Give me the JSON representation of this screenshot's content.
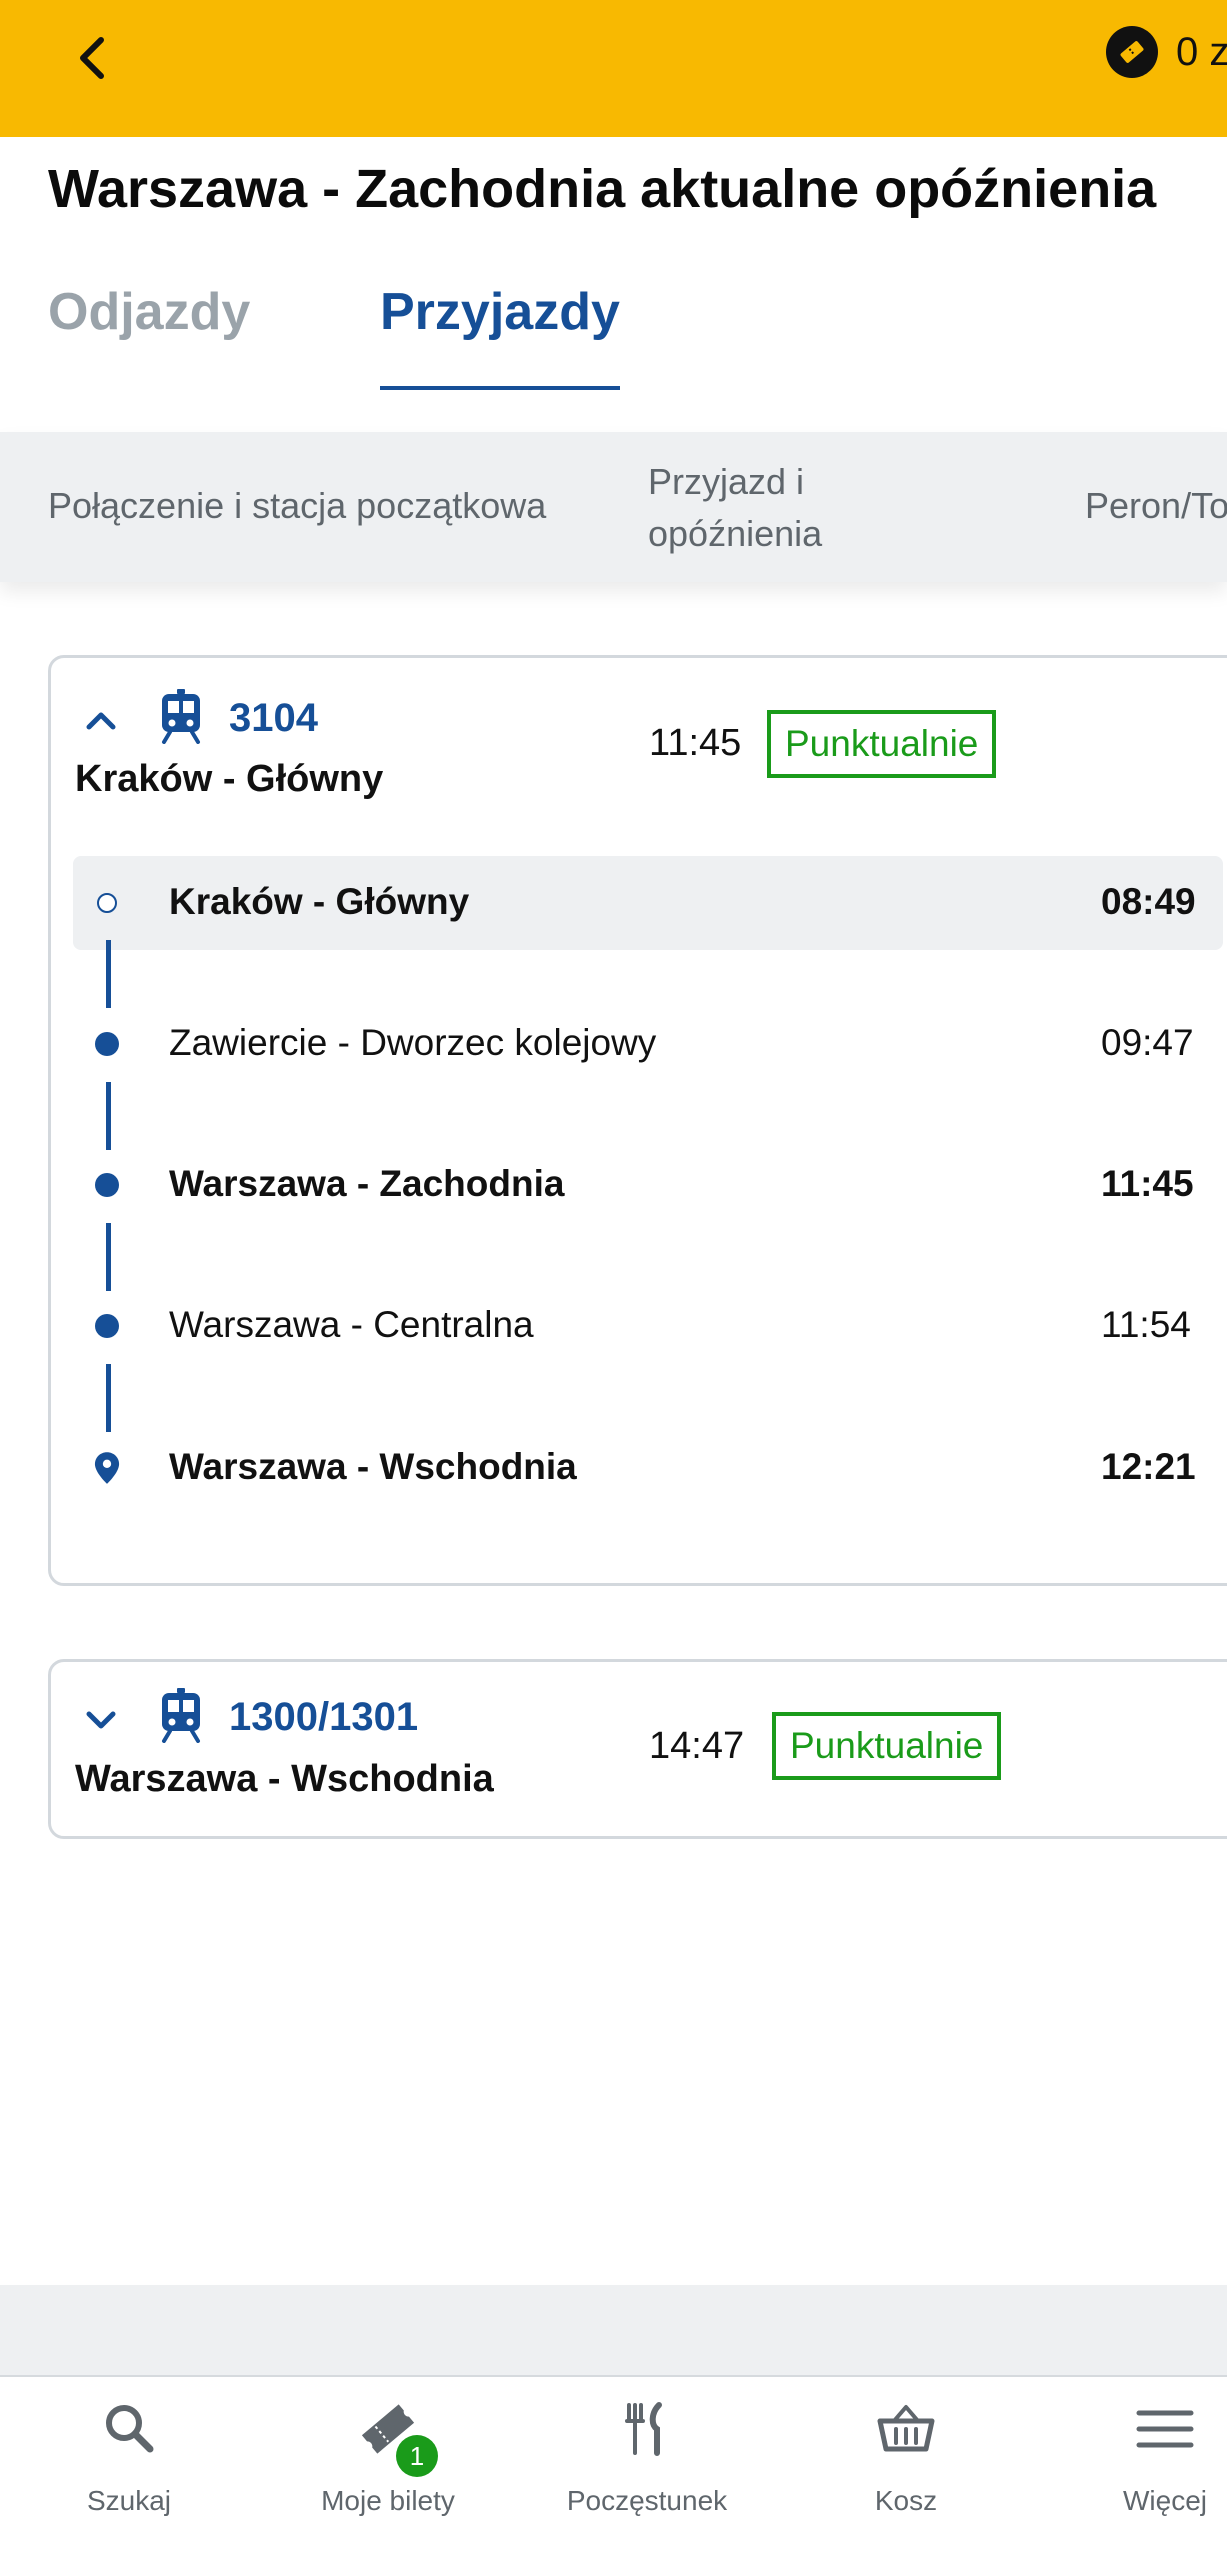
{
  "header": {
    "coins_text": "0 z",
    "colors": {
      "bar": "#f8b901",
      "accent": "#164f97",
      "ok": "#1a9b1a"
    }
  },
  "page": {
    "title": "Warszawa - Zachodnia aktualne opóźnienia"
  },
  "tabs": [
    {
      "label": "Odjazdy",
      "active": false
    },
    {
      "label": "Przyjazdy",
      "active": true
    }
  ],
  "table_header": {
    "connection": "Połączenie i stacja początkowa",
    "arrival": "Przyjazd i opóźnienia",
    "platform": "Peron/To"
  },
  "trains": [
    {
      "number": "3104",
      "origin": "Kraków - Główny",
      "arrival_time": "11:45",
      "status": "Punktualnie",
      "expanded": true,
      "stops": [
        {
          "name": "Kraków - Główny",
          "time": "08:49"
        },
        {
          "name": "Zawiercie - Dworzec kolejowy",
          "time": "09:47"
        },
        {
          "name": "Warszawa - Zachodnia",
          "time": "11:45"
        },
        {
          "name": "Warszawa - Centralna",
          "time": "11:54"
        },
        {
          "name": "Warszawa - Wschodnia",
          "time": "12:21"
        }
      ]
    },
    {
      "number": "1300/1301",
      "origin": "Warszawa - Wschodnia",
      "arrival_time": "14:47",
      "status": "Punktualnie",
      "expanded": false
    }
  ],
  "bottom_nav": [
    {
      "label": "Szukaj",
      "icon": "search-icon"
    },
    {
      "label": "Moje bilety",
      "icon": "ticket-icon",
      "badge": "1"
    },
    {
      "label": "Poczęstunek",
      "icon": "fork-knife-icon"
    },
    {
      "label": "Kosz",
      "icon": "basket-icon"
    },
    {
      "label": "Więcej",
      "icon": "menu-icon"
    }
  ]
}
